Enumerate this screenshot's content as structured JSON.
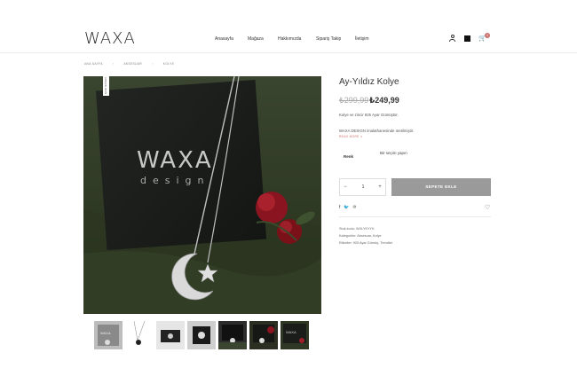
{
  "brand": {
    "logo_text": "WAXA"
  },
  "nav": {
    "items": [
      "Anasayfa",
      "Mağaza",
      "Hakkımızda",
      "Sipariş Takip",
      "İletişim"
    ]
  },
  "header_icons": {
    "user": "user-icon",
    "square": "square-icon",
    "cart": "cart-icon",
    "cart_count": "0",
    "accent": "#c9706c"
  },
  "breadcrumb": [
    "ANA SAYFA",
    "AKSESUAR",
    "KOLYE"
  ],
  "product": {
    "image_badge": "ÇOK SATAN",
    "title": "Ay-Yıldız Kolye",
    "old_price": "₺299,99",
    "new_price": "₺249,99",
    "desc1": "Kolye ve zincir 925 Ayar Gümüştür.",
    "desc2": "WAXA DESIGN imalathanesinde üretilmiştir.",
    "read_more": "READ MORE ∨",
    "variant_label": "Renk",
    "variant_value": "Bir seçim yapın",
    "quantity": "1",
    "qty_minus": "−",
    "qty_plus": "+",
    "add_to_cart": "SEPETE EKLE",
    "share_icons": [
      "f",
      "🐦",
      "℗"
    ],
    "sku": "Stok kodu: WXLYKYYK",
    "categories": "Kategoriler: Aksesuar, Kolye",
    "tags": "Etiketler: 925 Ayar Gümüş, Trendler"
  },
  "colors": {
    "accent": "#c9706c",
    "button": "#9a9a9a",
    "box": "#1c1f1c",
    "fabric": "#2f3a25"
  }
}
